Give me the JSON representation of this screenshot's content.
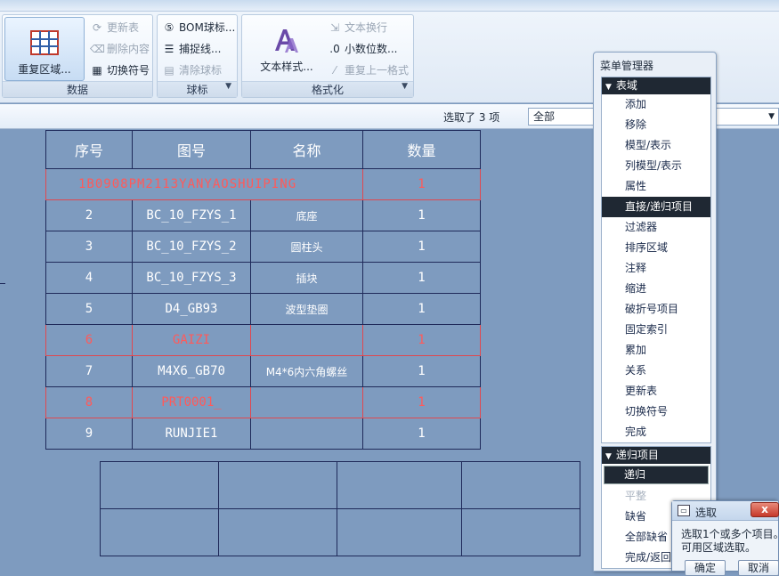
{
  "ribbon": {
    "groups": [
      {
        "label": "数据",
        "big_button": "重复区域...",
        "small_buttons": [
          "更新表",
          "删除内容",
          "切换符号"
        ]
      },
      {
        "label": "球标",
        "small_buttons": [
          "BOM球标...",
          "捕捉线...",
          "清除球标"
        ]
      },
      {
        "label": "格式化",
        "big_button": "文本样式...",
        "small_buttons": [
          "文本换行",
          "小数位数...",
          "重复上一格式"
        ]
      }
    ]
  },
  "toolbar": {
    "selection_status": "选取了 3 项",
    "filter_value": "全部"
  },
  "table": {
    "headers": [
      "序号",
      "图号",
      "名称",
      "数量"
    ],
    "rows": [
      {
        "merged": "1B0908PM2113YANYAOSHUIPING",
        "qty": "1",
        "highlight": true
      },
      {
        "no": "2",
        "code": "BC_10_FZYS_1",
        "name": "底座",
        "qty": "1",
        "highlight": false
      },
      {
        "no": "3",
        "code": "BC_10_FZYS_2",
        "name": "圆柱头",
        "qty": "1",
        "highlight": false
      },
      {
        "no": "4",
        "code": "BC_10_FZYS_3",
        "name": "插块",
        "qty": "1",
        "highlight": false
      },
      {
        "no": "5",
        "code": "D4_GB93",
        "name": "波型垫圈",
        "qty": "1",
        "highlight": false
      },
      {
        "no": "6",
        "code": "GAIZI",
        "name": "",
        "qty": "1",
        "highlight": true
      },
      {
        "no": "7",
        "code": "M4X6_GB70",
        "name": "M4*6内六角螺丝",
        "qty": "1",
        "highlight": false
      },
      {
        "no": "8",
        "code": "PRT0001_",
        "name": "",
        "qty": "1",
        "highlight": true
      },
      {
        "no": "9",
        "code": "RUNJIE1",
        "name": "",
        "qty": "1",
        "highlight": false
      }
    ]
  },
  "menu_manager": {
    "title": "菜单管理器",
    "section1": "表域",
    "items1": [
      "添加",
      "移除",
      "模型/表示",
      "列模型/表示",
      "属性",
      "直接/递归项目",
      "过滤器",
      "排序区域",
      "注释",
      "缩进",
      "破折号项目",
      "固定索引",
      "累加",
      "关系",
      "更新表",
      "切换符号",
      "完成"
    ],
    "section2": "递归项目",
    "items2": [
      "递归",
      "平整",
      "缺省",
      "全部缺省",
      "完成/返回"
    ]
  },
  "select_dialog": {
    "title": "选取",
    "close_glyph": "x",
    "message_line1": "选取1个或多个项目。",
    "message_line2": "可用区域选取。",
    "ok": "确定",
    "cancel": "取消"
  }
}
